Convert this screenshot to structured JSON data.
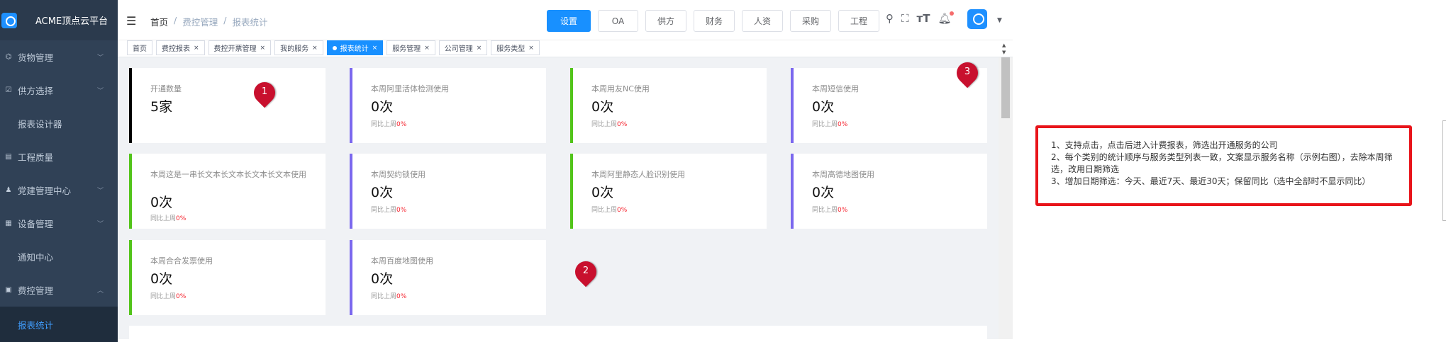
{
  "app": {
    "brand": "ACME顶点云平台"
  },
  "sidebar": {
    "items": [
      {
        "label": "货物管理",
        "icon": "box-icon",
        "glyph": "⌬",
        "has_children": true
      },
      {
        "label": "供方选择",
        "icon": "checkbox-icon",
        "glyph": "☑",
        "has_children": true
      },
      {
        "label": "报表设计器",
        "icon": "",
        "glyph": "",
        "has_children": false
      },
      {
        "label": "工程质量",
        "icon": "list-icon",
        "glyph": "▤",
        "has_children": false
      },
      {
        "label": "党建管理中心",
        "icon": "user-icon",
        "glyph": "♟",
        "has_children": true
      },
      {
        "label": "设备管理",
        "icon": "grid-icon",
        "glyph": "▦",
        "has_children": true
      },
      {
        "label": "通知中心",
        "icon": "",
        "glyph": "",
        "has_children": false
      },
      {
        "label": "费控管理",
        "icon": "document-icon",
        "glyph": "▣",
        "has_children": true,
        "expanded": true
      }
    ],
    "active_sub": "报表统计"
  },
  "header": {
    "breadcrumb": [
      "首页",
      "费控管理",
      "报表统计"
    ],
    "separator": "/",
    "nav_buttons": [
      {
        "label": "设置",
        "active": true
      },
      {
        "label": "OA",
        "active": false
      },
      {
        "label": "供方",
        "active": false
      },
      {
        "label": "财务",
        "active": false
      },
      {
        "label": "人资",
        "active": false
      },
      {
        "label": "采购",
        "active": false
      },
      {
        "label": "工程",
        "active": false
      }
    ],
    "tools": [
      "search-icon",
      "fullscreen-icon",
      "font-size-icon",
      "bell-icon"
    ]
  },
  "tags": [
    {
      "label": "首页",
      "closable": false,
      "active": false
    },
    {
      "label": "费控报表",
      "closable": true,
      "active": false
    },
    {
      "label": "费控开票管理",
      "closable": true,
      "active": false
    },
    {
      "label": "我的服务",
      "closable": true,
      "active": false
    },
    {
      "label": "报表统计",
      "closable": true,
      "active": true
    },
    {
      "label": "服务管理",
      "closable": true,
      "active": false
    },
    {
      "label": "公司管理",
      "closable": true,
      "active": false
    },
    {
      "label": "服务类型",
      "closable": true,
      "active": false
    }
  ],
  "cards": [
    {
      "name": "开通数量",
      "value": "5家",
      "compare": "",
      "pct": "",
      "accent": "#000000"
    },
    {
      "name": "本周阿里活体检测使用",
      "value": "0次",
      "compare": "同比上周",
      "pct": "0%",
      "accent": "#7b68ee"
    },
    {
      "name": "本周用友NC使用",
      "value": "0次",
      "compare": "同比上周",
      "pct": "0%",
      "accent": "#52c41a"
    },
    {
      "name": "本周短信使用",
      "value": "0次",
      "compare": "同比上周",
      "pct": "0%",
      "accent": "#7b68ee"
    },
    {
      "name": "本周这是一串长文本长文本长文本长文本使用",
      "value": "0次",
      "compare": "同比上周",
      "pct": "0%",
      "accent": "#52c41a"
    },
    {
      "name": "本周契约锁使用",
      "value": "0次",
      "compare": "同比上周",
      "pct": "0%",
      "accent": "#7b68ee"
    },
    {
      "name": "本周阿里静态人脸识别使用",
      "value": "0次",
      "compare": "同比上周",
      "pct": "0%",
      "accent": "#52c41a"
    },
    {
      "name": "本周高德地图使用",
      "value": "0次",
      "compare": "同比上周",
      "pct": "0%",
      "accent": "#7b68ee"
    },
    {
      "name": "本周合合发票使用",
      "value": "0次",
      "compare": "同比上周",
      "pct": "0%",
      "accent": "#52c41a"
    },
    {
      "name": "本周百度地图使用",
      "value": "0次",
      "compare": "同比上周",
      "pct": "0%",
      "accent": "#7b68ee"
    }
  ],
  "markers": [
    "1",
    "2",
    "3"
  ],
  "annotation": {
    "lines": [
      "1、支持点击，点击后进入计费报表，筛选出开通服务的公司",
      "2、每个类别的统计顺序与服务类型列表一致，文案显示服务名称（示例右图），去除本周筛选，改用日期筛选",
      "3、增加日期筛选：今天、最近7天、最近30天；保留同比（选中全部时不显示同比）"
    ]
  }
}
